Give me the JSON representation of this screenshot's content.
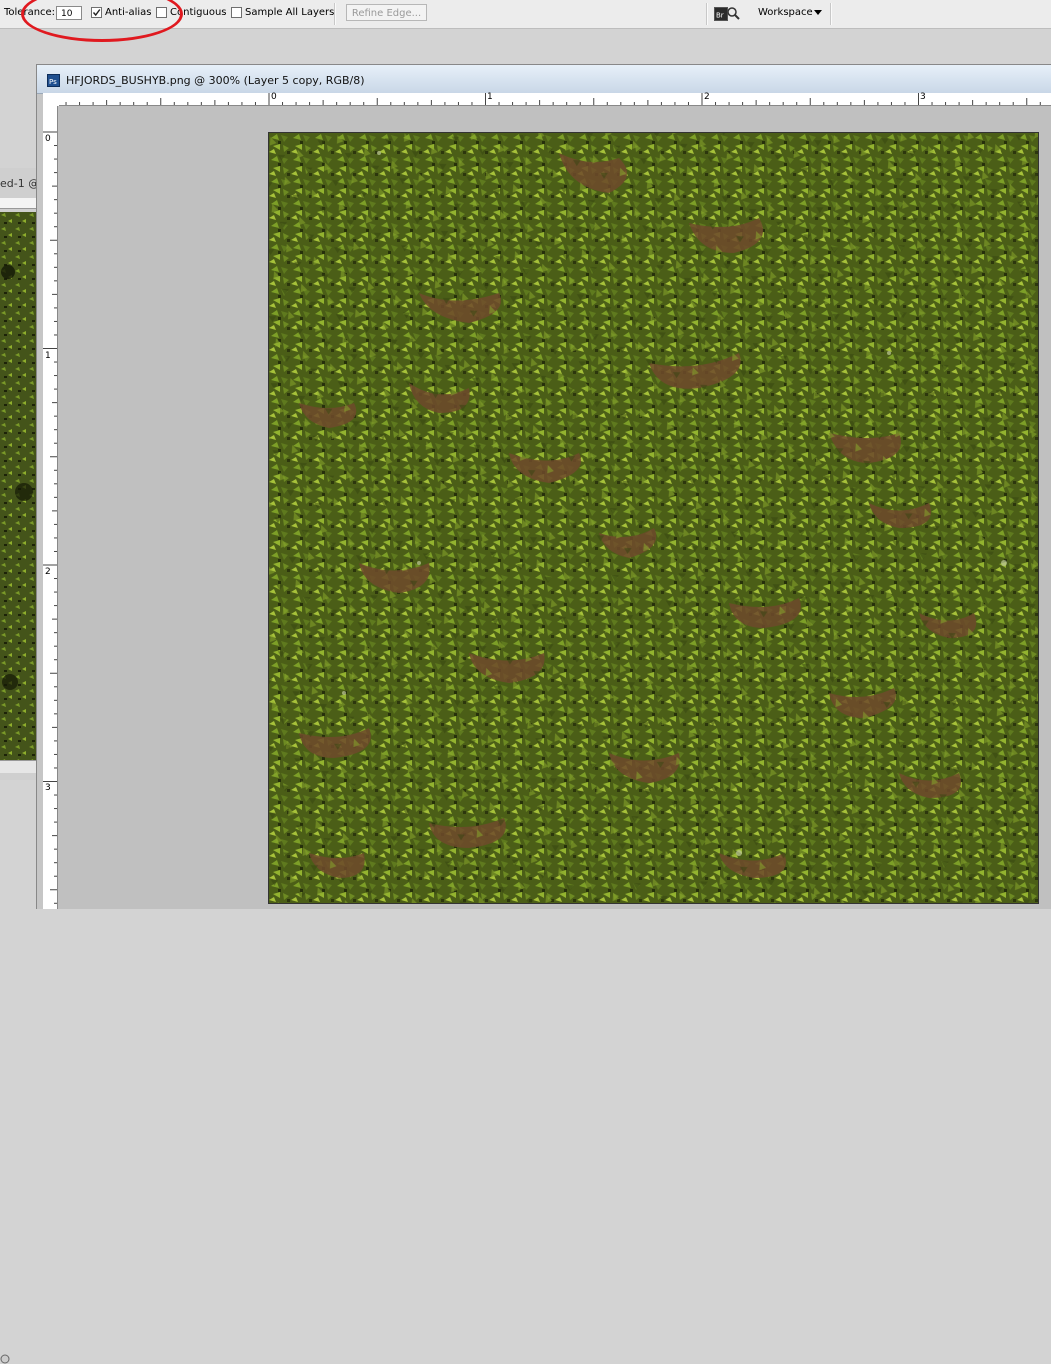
{
  "options_bar": {
    "tolerance_label": "Tolerance:",
    "tolerance_value": "10",
    "anti_alias_label": "Anti-alias",
    "anti_alias_checked": true,
    "contiguous_label": "Contiguous",
    "contiguous_checked": false,
    "sample_all_layers_label": "Sample All Layers",
    "sample_all_layers_checked": false,
    "refine_edge_label": "Refine Edge...",
    "bridge_icon": "Br",
    "workspace_label": "Workspace"
  },
  "background_document": {
    "title": "ed-1 @"
  },
  "document": {
    "title": "HFJORDS_BUSHYB.png @ 300% (Layer 5 copy, RGB/8)",
    "icon": "Ps",
    "h_ruler_labels": [
      "0",
      "1",
      "2",
      "3"
    ],
    "v_ruler_labels": [
      "0",
      "1",
      "2",
      "3"
    ]
  },
  "colors": {
    "annotation": "#e0191f",
    "foliage_dark": "#3b4a12",
    "foliage_mid": "#5f7a1e",
    "foliage_light": "#8fae2c",
    "soil": "#6e4a2c"
  },
  "icons": {
    "workspace_arrow": "chevron-down-icon",
    "bridge": "bridge-icon",
    "document": "photoshop-doc-icon"
  }
}
